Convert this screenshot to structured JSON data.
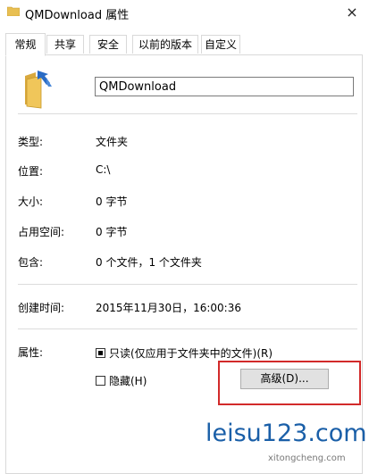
{
  "window": {
    "title": "QMDownload 属性",
    "close_glyph": "×"
  },
  "tabs": [
    {
      "label": "常规",
      "active": true
    },
    {
      "label": "共享",
      "active": false
    },
    {
      "label": "安全",
      "active": false
    },
    {
      "label": "以前的版本",
      "active": false
    },
    {
      "label": "自定义",
      "active": false
    }
  ],
  "folder": {
    "icon": "folder-shortcut-icon",
    "name_value": "QMDownload"
  },
  "info": {
    "type_label": "类型:",
    "type_value": "文件夹",
    "location_label": "位置:",
    "location_value": "C:\\",
    "size_label": "大小:",
    "size_value": "0 字节",
    "disk_size_label": "占用空间:",
    "disk_size_value": "0 字节",
    "contains_label": "包含:",
    "contains_value": "0 个文件，1 个文件夹",
    "created_label": "创建时间:",
    "created_value": "2015年11月30日，16:00:36"
  },
  "attributes": {
    "label": "属性:",
    "readonly_label": "只读(仅应用于文件夹中的文件)(R)",
    "readonly_state": "indeterminate",
    "hidden_label": "隐藏(H)",
    "hidden_checked": false,
    "advanced_button": "高级(D)..."
  },
  "watermark": {
    "main": "leisu123.com",
    "sub": "xitongcheng.com"
  },
  "colors": {
    "highlight": "#d22a2a",
    "folder": "#e8bf52",
    "arrow": "#2a6bc4",
    "watermark": "#1a5fa8"
  }
}
